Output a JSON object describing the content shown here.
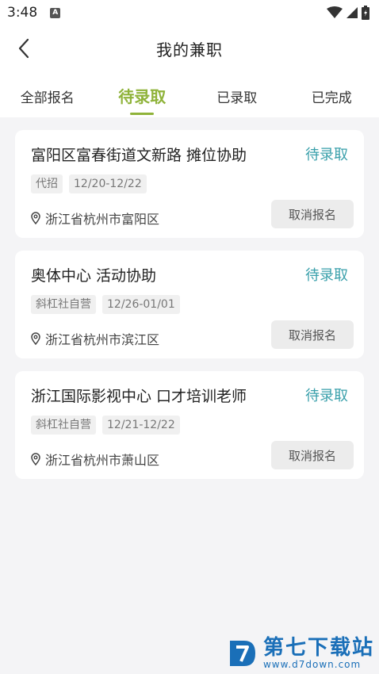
{
  "status_bar": {
    "time": "3:48",
    "notification_badge": "A",
    "icons": [
      "wifi-icon",
      "signal-icon",
      "battery-icon"
    ]
  },
  "nav": {
    "title": "我的兼职"
  },
  "tabs": [
    {
      "label": "全部报名",
      "active": false
    },
    {
      "label": "待录取",
      "active": true
    },
    {
      "label": "已录取",
      "active": false
    },
    {
      "label": "已完成",
      "active": false
    }
  ],
  "jobs": [
    {
      "title": "富阳区富春街道文新路 摊位协助",
      "status": "待录取",
      "tags": [
        "代招",
        "12/20-12/22"
      ],
      "location": "浙江省杭州市富阳区",
      "action": "取消报名"
    },
    {
      "title": "奥体中心 活动协助",
      "status": "待录取",
      "tags": [
        "斜杠社自营",
        "12/26-01/01"
      ],
      "location": "浙江省杭州市滨江区",
      "action": "取消报名"
    },
    {
      "title": "浙江国际影视中心 口才培训老师",
      "status": "待录取",
      "tags": [
        "斜杠社自营",
        "12/21-12/22"
      ],
      "location": "浙江省杭州市萧山区",
      "action": "取消报名"
    }
  ],
  "watermark": {
    "name": "第七下载站",
    "url": "www.d7down.com"
  },
  "colors": {
    "accent": "#8fb33a",
    "status": "#3aa0ab",
    "background": "#f4f4f6",
    "brand": "#1a6fb8"
  }
}
